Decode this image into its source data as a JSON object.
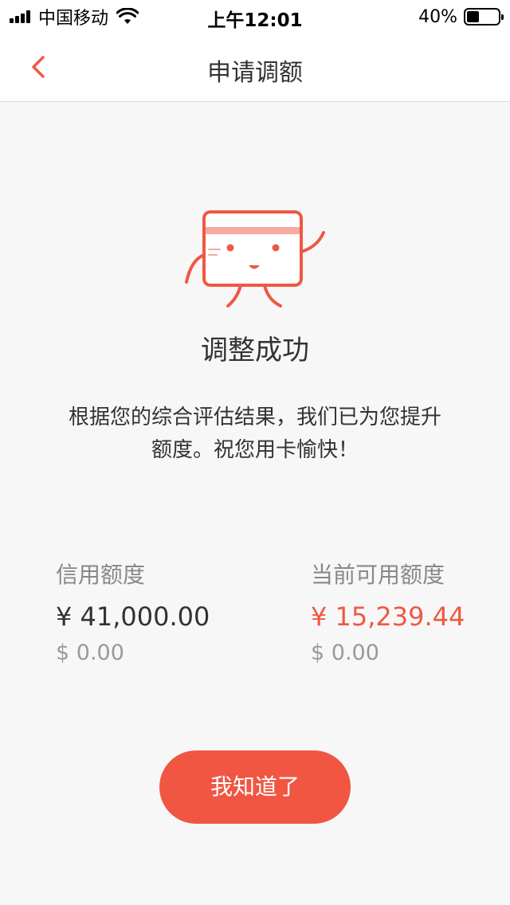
{
  "status_bar": {
    "carrier": "中国移动",
    "time": "上午12:01",
    "battery": "40%",
    "battery_level": 0.4,
    "icons": [
      "signal-icon",
      "wifi-icon",
      "battery-icon"
    ]
  },
  "nav": {
    "title": "申请调额",
    "back_icon": "chevron-left-icon"
  },
  "result": {
    "icon": "card-mascot-icon",
    "title": "调整成功",
    "description": "根据您的综合评估结果，我们已为您提升额度。祝您用卡愉快！"
  },
  "credit_limit": {
    "label": "信用额度",
    "rmb": "¥ 41,000.00",
    "usd": "$ 0.00"
  },
  "available_limit": {
    "label": "当前可用额度",
    "rmb": "¥ 15,239.44",
    "usd": "$ 0.00"
  },
  "confirm_button": {
    "label": "我知道了"
  },
  "colors": {
    "accent": "#f05642",
    "background": "#f7f7f7",
    "text": "#333333",
    "muted": "#999999"
  }
}
